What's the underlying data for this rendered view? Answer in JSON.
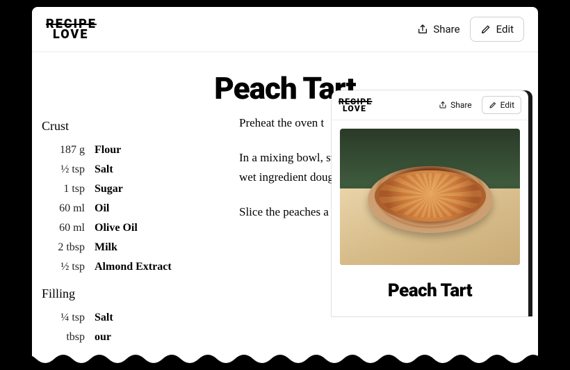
{
  "brand": {
    "line1": "RECIPE",
    "line2": "LOVE"
  },
  "actions": {
    "share": "Share",
    "edit": "Edit"
  },
  "recipe": {
    "title": "Peach Tart",
    "sections": [
      {
        "name": "Crust",
        "items": [
          {
            "qty": "187 g",
            "name": "Flour"
          },
          {
            "qty": "½ tsp",
            "name": "Salt"
          },
          {
            "qty": "1 tsp",
            "name": "Sugar"
          },
          {
            "qty": "60 ml",
            "name": "Oil"
          },
          {
            "qty": "60 ml",
            "name": "Olive Oil"
          },
          {
            "qty": "2 tbsp",
            "name": "Milk"
          },
          {
            "qty": "½ tsp",
            "name": "Almond Extract"
          }
        ]
      },
      {
        "name": "Filling",
        "items": [
          {
            "qty": "¼ tsp",
            "name": "Salt"
          },
          {
            "qty": "tbsp",
            "name": "our"
          }
        ]
      }
    ],
    "instructions": [
      "Preheat the oven t",
      "In a mixing bowl, sugar. In a separat togeter the oils, m the wet ingredient dough comes toge with your hands.",
      "Slice the peaches a dough"
    ]
  },
  "card": {
    "title": "Peach Tart"
  }
}
